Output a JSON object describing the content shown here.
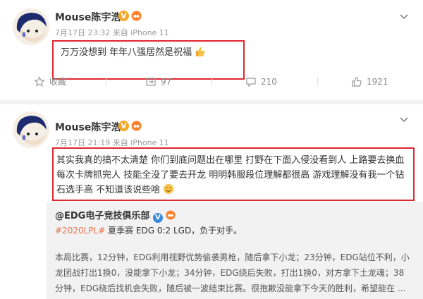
{
  "post1": {
    "username": "Mouse陈宇浩",
    "meta": "7月17日 23:32 来自 iPhone 11",
    "text": "万万没想到 年年八强居然是祝福",
    "actions": {
      "favorite": "收藏",
      "repost": "97",
      "comment": "210",
      "like": "1921"
    }
  },
  "post2": {
    "username": "Mouse陈宇浩",
    "meta": "7月17日 21:19 来自 iPhone 11",
    "text": "其实我真的搞不太清楚 你们到底问题出在哪里 打野在下面入侵没看到人 上路要去换血 每次卡牌抓完人 技能全没了要去开龙 明明韩服段位理解都很高 游戏理解没有我一个钻石选手高 不知道该说些啥",
    "retweet": {
      "user": "@EDG电子竞技俱乐部",
      "topic_tag": "#2020LPL#",
      "topic_text": " 夏季赛 EDG 0:2 LGD，负于对手。",
      "body": "本局比赛，12分钟，EDG利用视野优势偷袭男枪，随后拿下小龙；23分钟，EDG站位不利，小龙团战打出1换0，没能拿下小龙；34分钟，EDG绕后失败，打出1换0，对方拿下土龙魂；38分钟，EDG绕后找机会失败，随后被一波结束比赛。很抱歉没能拿下今天的胜利，希望能在 ..."
    }
  },
  "colors": {
    "highlight_box": "#e0262f",
    "verified_badge": "#f5a623",
    "topic_link": "#eb7350"
  },
  "icons": [
    "avatar",
    "verified-v-icon",
    "member-badge-icon",
    "chevron-down-icon",
    "star-icon",
    "repost-icon",
    "comment-icon",
    "like-icon",
    "thumbs-up-emoji",
    "smile-emoji"
  ]
}
